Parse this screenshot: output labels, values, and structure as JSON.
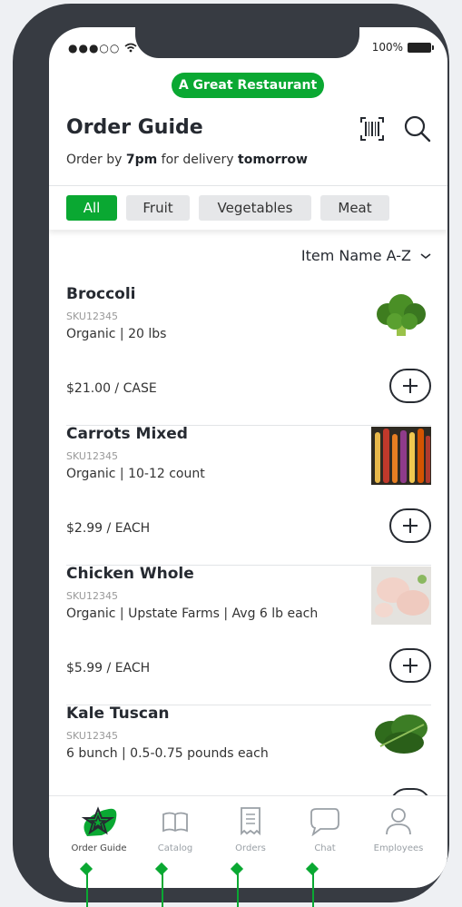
{
  "status_bar": {
    "signal": "●●●○○",
    "battery": "100%"
  },
  "restaurant": "A Great Restaurant",
  "title": "Order Guide",
  "subtitle": {
    "prefix": "Order by ",
    "time": "7pm",
    "middle": " for delivery ",
    "day": "tomorrow"
  },
  "filters": [
    "All",
    "Fruit",
    "Vegetables",
    "Meat"
  ],
  "sort": "Item Name A-Z",
  "items": [
    {
      "name": "Broccoli",
      "sku": "SKU12345",
      "desc": "Organic | 20 lbs",
      "price": "$21.00 / CASE",
      "image": "broccoli"
    },
    {
      "name": "Carrots Mixed",
      "sku": "SKU12345",
      "desc": "Organic | 10-12 count",
      "price": "$2.99 / EACH",
      "image": "carrots"
    },
    {
      "name": "Chicken Whole",
      "sku": "SKU12345",
      "desc": "Organic | Upstate Farms | Avg 6 lb each",
      "price": "$5.99 / EACH",
      "image": "chicken"
    },
    {
      "name": "Kale Tuscan",
      "sku": "SKU12345",
      "desc": "6 bunch | 0.5-0.75 pounds each",
      "price": "",
      "image": "kale"
    }
  ],
  "tabs": [
    {
      "label": "Order Guide",
      "icon": "star-icon"
    },
    {
      "label": "Catalog",
      "icon": "book-icon"
    },
    {
      "label": "Orders",
      "icon": "receipt-icon"
    },
    {
      "label": "Chat",
      "icon": "chat-icon"
    },
    {
      "label": "Employees",
      "icon": "person-icon"
    }
  ],
  "colors": {
    "accent": "#0aa832",
    "frame": "#373b42",
    "text": "#262a31"
  }
}
